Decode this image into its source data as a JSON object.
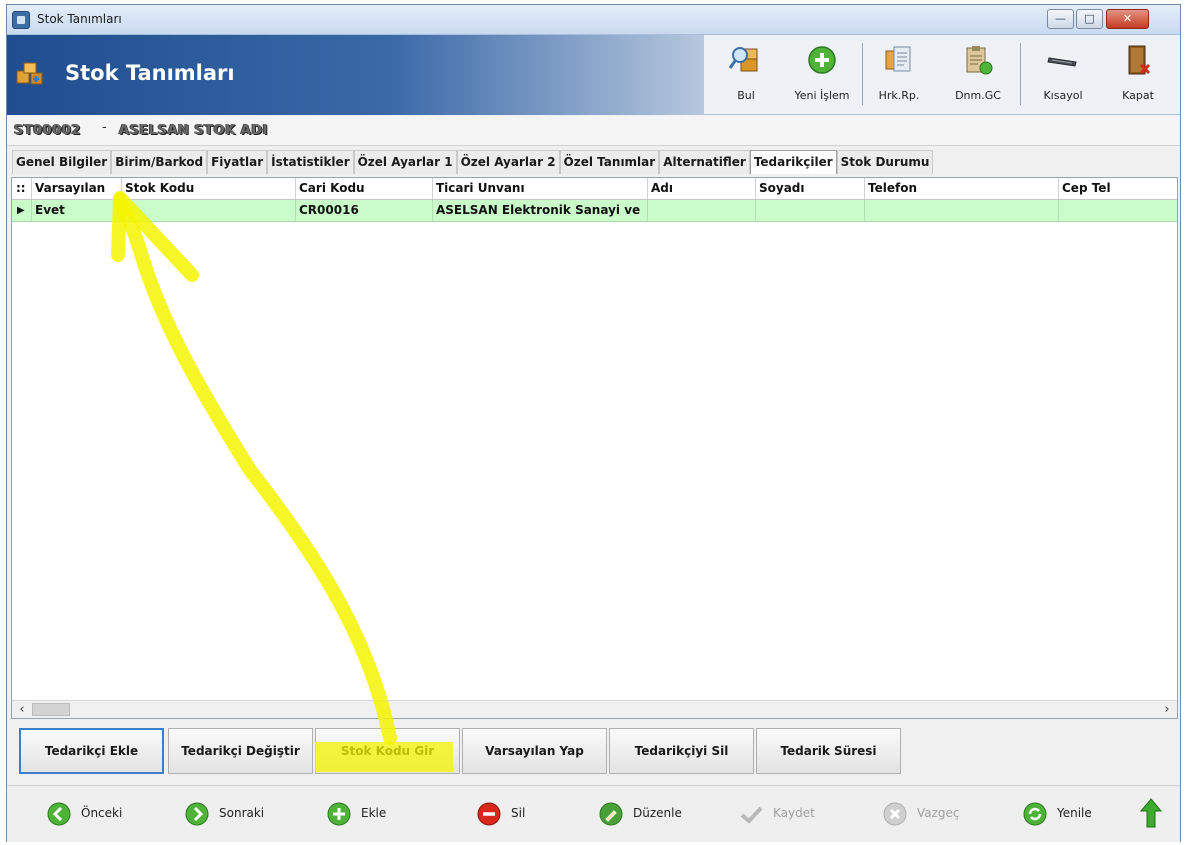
{
  "window": {
    "title": "Stok Tanımları"
  },
  "header": {
    "title": "Stok Tanımları"
  },
  "toolbar": [
    {
      "label": "Bul",
      "icon": "magnifier-boxes-icon"
    },
    {
      "label": "Yeni İşlem",
      "icon": "green-plus-icon"
    },
    {
      "label": "Hrk.Rp.",
      "icon": "document-stack-icon"
    },
    {
      "label": "Dnm.GC",
      "icon": "clipboard-refresh-icon"
    },
    {
      "label": "Kısayol",
      "icon": "keyboard-icon"
    },
    {
      "label": "Kapat",
      "icon": "exit-door-icon"
    }
  ],
  "stock": {
    "code": "ST00002",
    "separator": "-",
    "name": "ASELSAN STOK ADI"
  },
  "tabs": [
    {
      "label": "Genel Bilgiler"
    },
    {
      "label": "Birim/Barkod"
    },
    {
      "label": "Fiyatlar"
    },
    {
      "label": "İstatistikler"
    },
    {
      "label": "Özel Ayarlar 1"
    },
    {
      "label": "Özel Ayarlar 2"
    },
    {
      "label": "Özel Tanımlar"
    },
    {
      "label": "Alternatifler"
    },
    {
      "label": "Tedarikçiler",
      "active": true
    },
    {
      "label": "Stok Durumu"
    }
  ],
  "grid": {
    "indicator": "::",
    "columns": [
      "Varsayılan",
      "Stok Kodu",
      "Cari Kodu",
      "Ticari Unvanı",
      "Adı",
      "Soyadı",
      "Telefon",
      "Cep Tel"
    ],
    "rows": [
      {
        "marker": "▶",
        "cells": [
          "Evet",
          "",
          "CR00016",
          "ASELSAN Elektronik Sanayi ve",
          "",
          "",
          "",
          ""
        ]
      }
    ],
    "row_color": "#c9fcc9"
  },
  "actions": [
    {
      "label": "Tedarikçi Ekle"
    },
    {
      "label": "Tedarikçi Değiştir"
    },
    {
      "label": "Stok Kodu Gir"
    },
    {
      "label": "Varsayılan Yap"
    },
    {
      "label": "Tedarikçiyi Sil"
    },
    {
      "label": "Tedarik Süresi"
    }
  ],
  "nav": [
    {
      "label": "Önceki",
      "icon": "green-arrow-left-icon",
      "enabled": true
    },
    {
      "label": "Sonraki",
      "icon": "green-arrow-right-icon",
      "enabled": true
    },
    {
      "label": "Ekle",
      "icon": "green-plus-icon",
      "enabled": true
    },
    {
      "label": "Sil",
      "icon": "red-minus-icon",
      "enabled": true
    },
    {
      "label": "Düzenle",
      "icon": "pencil-icon",
      "enabled": true
    },
    {
      "label": "Kaydet",
      "icon": "checkmark-icon",
      "enabled": false
    },
    {
      "label": "Vazgeç",
      "icon": "cancel-x-icon",
      "enabled": false
    },
    {
      "label": "Yenile",
      "icon": "refresh-icon",
      "enabled": true
    },
    {
      "label": "",
      "icon": "up-arrow-icon",
      "enabled": true
    }
  ],
  "colors": {
    "highlighter": "#f4f400",
    "banner": "#1f4d8f",
    "accent_focus": "#3c7fc4"
  }
}
